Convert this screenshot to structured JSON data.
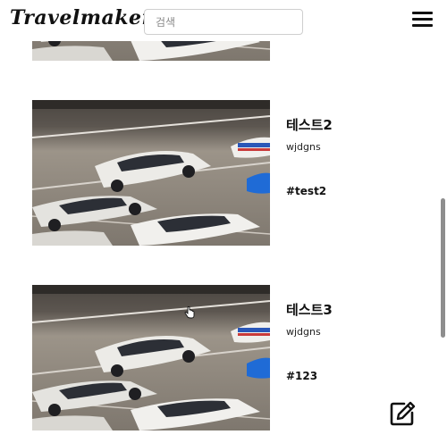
{
  "header": {
    "logo": "Travelmaker",
    "search_placeholder": "검색",
    "menu_icon": "hamburger-menu-icon"
  },
  "posts": [
    {
      "title": "",
      "author": "",
      "tag": "",
      "image": "race-cars-photo"
    },
    {
      "title": "테스트2",
      "author": "wjdgns",
      "tag": "#test2",
      "image": "race-cars-photo"
    },
    {
      "title": "테스트3",
      "author": "wjdgns",
      "tag": "#123",
      "image": "race-cars-photo"
    }
  ],
  "write_button": {
    "icon": "edit-icon"
  }
}
